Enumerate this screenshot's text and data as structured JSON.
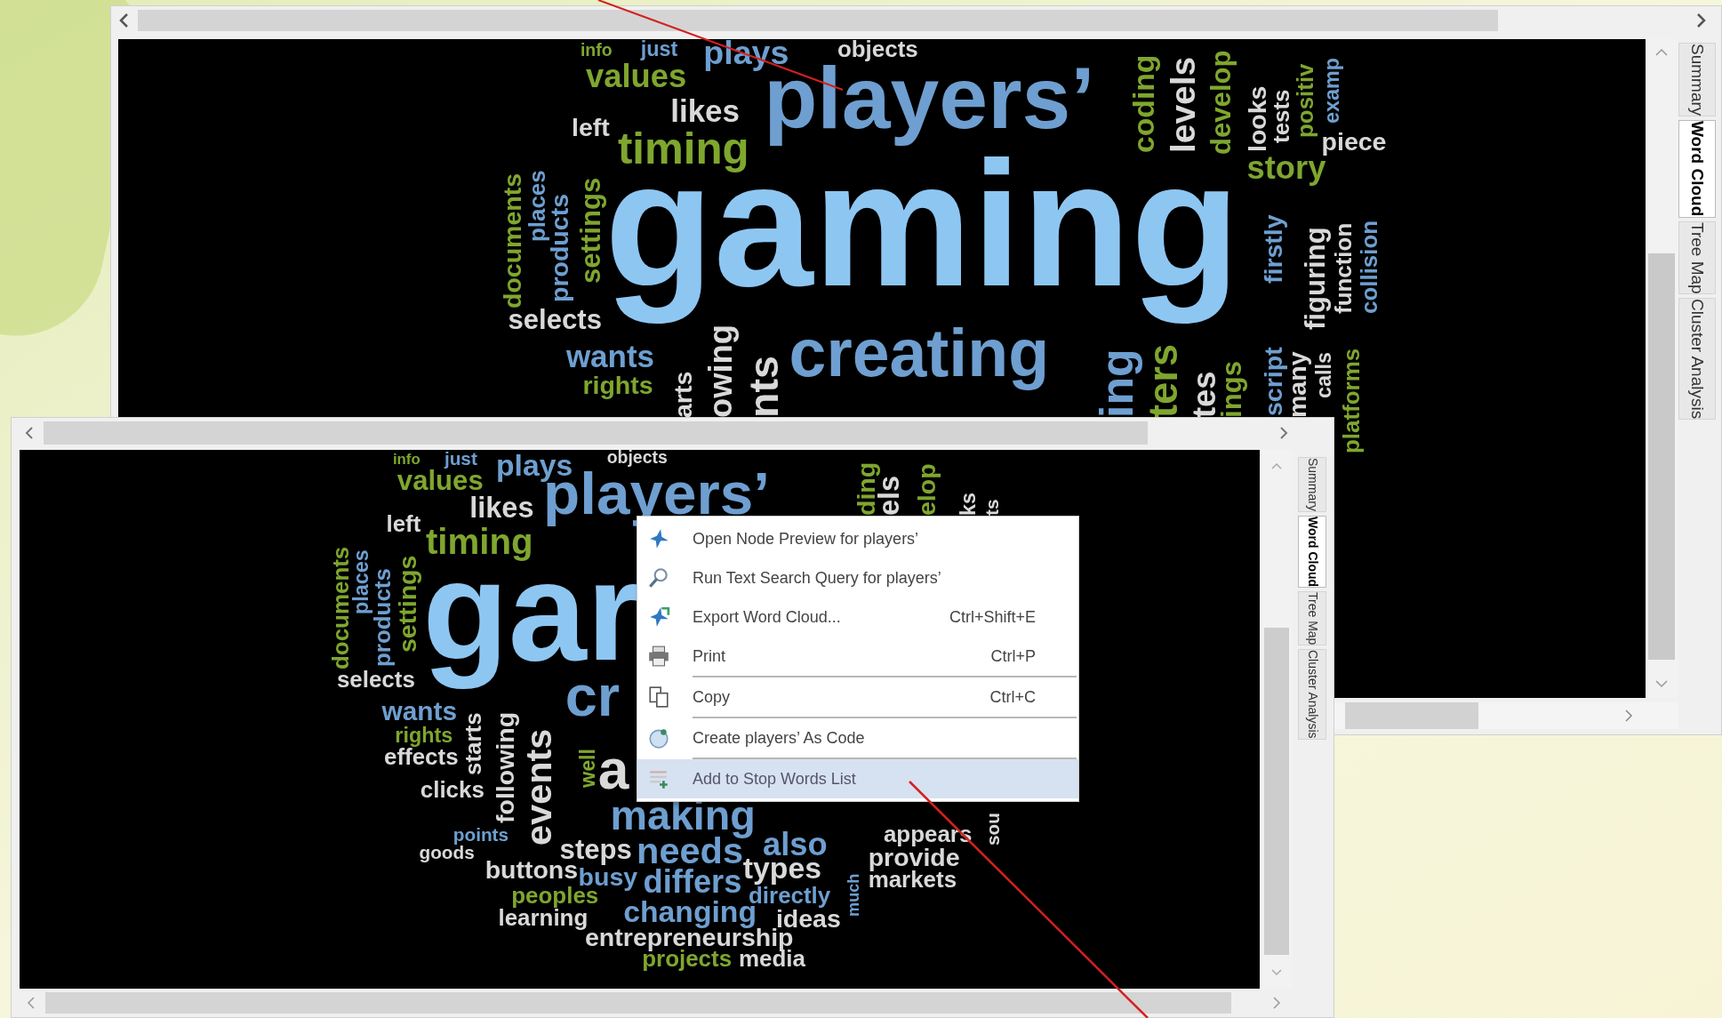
{
  "windows": [
    {
      "tabs": [
        {
          "label": "Summary",
          "selected": false
        },
        {
          "label": "Word Cloud",
          "selected": true
        },
        {
          "label": "Tree Map",
          "selected": false
        },
        {
          "label": "Cluster Analysis",
          "selected": false
        }
      ],
      "cloud": {
        "words": [
          {
            "text": "info",
            "color": "#7fa62f",
            "vertical": false
          },
          {
            "text": "just",
            "color": "#6e9fd0",
            "vertical": false
          },
          {
            "text": "plays",
            "color": "#6e9fd0",
            "vertical": false
          },
          {
            "text": "objects",
            "color": "#d9d9d9",
            "vertical": false
          },
          {
            "text": "values",
            "color": "#7fa62f",
            "vertical": false
          },
          {
            "text": "likes",
            "color": "#d9d9d9",
            "vertical": false
          },
          {
            "text": "left",
            "color": "#d9d9d9",
            "vertical": false
          },
          {
            "text": "players’",
            "color": "#6e9fd0",
            "vertical": false
          },
          {
            "text": "timing",
            "color": "#7fa62f",
            "vertical": false
          },
          {
            "text": "documents",
            "color": "#7fa62f",
            "vertical": true
          },
          {
            "text": "places",
            "color": "#6e9fd0",
            "vertical": true
          },
          {
            "text": "products",
            "color": "#6e9fd0",
            "vertical": true
          },
          {
            "text": "settings",
            "color": "#7fa62f",
            "vertical": true
          },
          {
            "text": "selects",
            "color": "#d9d9d9",
            "vertical": false
          },
          {
            "text": "gaming",
            "color": "#8ec6f2",
            "vertical": false
          },
          {
            "text": "wants",
            "color": "#6e9fd0",
            "vertical": false
          },
          {
            "text": "rights",
            "color": "#7fa62f",
            "vertical": false
          },
          {
            "text": "creating",
            "color": "#6e9fd0",
            "vertical": false
          },
          {
            "text": "coding",
            "color": "#7fa62f",
            "vertical": true
          },
          {
            "text": "levels",
            "color": "#d9d9d9",
            "vertical": true
          },
          {
            "text": "develop",
            "color": "#7fa62f",
            "vertical": true
          },
          {
            "text": "looks",
            "color": "#d9d9d9",
            "vertical": true
          },
          {
            "text": "tests",
            "color": "#d9d9d9",
            "vertical": true
          },
          {
            "text": "positiv",
            "color": "#7fa62f",
            "vertical": true
          },
          {
            "text": "examp",
            "color": "#6e9fd0",
            "vertical": true
          },
          {
            "text": "piece",
            "color": "#d9d9d9",
            "vertical": false
          },
          {
            "text": "story",
            "color": "#7fa62f",
            "vertical": false
          },
          {
            "text": "firstly",
            "color": "#6e9fd0",
            "vertical": true
          },
          {
            "text": "figuring",
            "color": "#d9d9d9",
            "vertical": true
          },
          {
            "text": "function",
            "color": "#d9d9d9",
            "vertical": true
          },
          {
            "text": "collision",
            "color": "#6e9fd0",
            "vertical": true
          },
          {
            "text": "script",
            "color": "#6e9fd0",
            "vertical": true
          },
          {
            "text": "many",
            "color": "#d9d9d9",
            "vertical": true
          },
          {
            "text": "calls",
            "color": "#d9d9d9",
            "vertical": true
          },
          {
            "text": "platforms",
            "color": "#7fa62f",
            "vertical": true
          },
          {
            "text": "nts",
            "color": "#d9d9d9",
            "vertical": true
          },
          {
            "text": "ing",
            "color": "#6e9fd0",
            "vertical": true
          },
          {
            "text": "ters",
            "color": "#7fa62f",
            "vertical": true
          },
          {
            "text": "tes",
            "color": "#d9d9d9",
            "vertical": true
          },
          {
            "text": "ings",
            "color": "#7fa62f",
            "vertical": true
          },
          {
            "text": "owing",
            "color": "#d9d9d9",
            "vertical": true
          },
          {
            "text": "arts",
            "color": "#d9d9d9",
            "vertical": true
          }
        ]
      }
    },
    {
      "tabs": [
        {
          "label": "Summary",
          "selected": false
        },
        {
          "label": "Word Cloud",
          "selected": true
        },
        {
          "label": "Tree Map",
          "selected": false
        },
        {
          "label": "Cluster Analysis",
          "selected": false
        }
      ],
      "cloud": {
        "words": [
          {
            "text": "info",
            "color": "#7fa62f",
            "vertical": false
          },
          {
            "text": "just",
            "color": "#6e9fd0",
            "vertical": false
          },
          {
            "text": "plays",
            "color": "#6e9fd0",
            "vertical": false
          },
          {
            "text": "objects",
            "color": "#d9d9d9",
            "vertical": false
          },
          {
            "text": "values",
            "color": "#7fa62f",
            "vertical": false
          },
          {
            "text": "likes",
            "color": "#d9d9d9",
            "vertical": false
          },
          {
            "text": "left",
            "color": "#d9d9d9",
            "vertical": false
          },
          {
            "text": "players’",
            "color": "#6e9fd0",
            "vertical": false
          },
          {
            "text": "timing",
            "color": "#7fa62f",
            "vertical": false
          },
          {
            "text": "documents",
            "color": "#7fa62f",
            "vertical": true
          },
          {
            "text": "places",
            "color": "#6e9fd0",
            "vertical": true
          },
          {
            "text": "products",
            "color": "#6e9fd0",
            "vertical": true
          },
          {
            "text": "settings",
            "color": "#7fa62f",
            "vertical": true
          },
          {
            "text": "selects",
            "color": "#d9d9d9",
            "vertical": false
          },
          {
            "text": "gar",
            "color": "#8ec6f2",
            "vertical": false
          },
          {
            "text": "wants",
            "color": "#6e9fd0",
            "vertical": false
          },
          {
            "text": "rights",
            "color": "#7fa62f",
            "vertical": false
          },
          {
            "text": "effects",
            "color": "#d9d9d9",
            "vertical": false
          },
          {
            "text": "clicks",
            "color": "#d9d9d9",
            "vertical": false
          },
          {
            "text": "points",
            "color": "#6e9fd0",
            "vertical": false
          },
          {
            "text": "goods",
            "color": "#d9d9d9",
            "vertical": false
          },
          {
            "text": "starts",
            "color": "#d9d9d9",
            "vertical": true
          },
          {
            "text": "following",
            "color": "#d9d9d9",
            "vertical": true
          },
          {
            "text": "events",
            "color": "#d9d9d9",
            "vertical": true
          },
          {
            "text": "well",
            "color": "#7fa62f",
            "vertical": true
          },
          {
            "text": "cr",
            "color": "#6e9fd0",
            "vertical": false
          },
          {
            "text": "a",
            "color": "#d9d9d9",
            "vertical": false
          },
          {
            "text": "making",
            "color": "#6e9fd0",
            "vertical": false
          },
          {
            "text": "steps",
            "color": "#d9d9d9",
            "vertical": false
          },
          {
            "text": "needs",
            "color": "#6e9fd0",
            "vertical": false
          },
          {
            "text": "also",
            "color": "#6e9fd0",
            "vertical": false
          },
          {
            "text": "buttons",
            "color": "#d9d9d9",
            "vertical": false
          },
          {
            "text": "busy",
            "color": "#6e9fd0",
            "vertical": false
          },
          {
            "text": "differs",
            "color": "#6e9fd0",
            "vertical": false
          },
          {
            "text": "types",
            "color": "#d9d9d9",
            "vertical": false
          },
          {
            "text": "peoples",
            "color": "#7fa62f",
            "vertical": false
          },
          {
            "text": "directly",
            "color": "#6e9fd0",
            "vertical": false
          },
          {
            "text": "learning",
            "color": "#d9d9d9",
            "vertical": false
          },
          {
            "text": "changing",
            "color": "#6e9fd0",
            "vertical": false
          },
          {
            "text": "ideas",
            "color": "#d9d9d9",
            "vertical": false
          },
          {
            "text": "entrepreneurship",
            "color": "#d9d9d9",
            "vertical": false
          },
          {
            "text": "projects",
            "color": "#7fa62f",
            "vertical": false
          },
          {
            "text": "media",
            "color": "#d9d9d9",
            "vertical": false
          },
          {
            "text": "much",
            "color": "#6e9fd0",
            "vertical": true
          },
          {
            "text": "appears",
            "color": "#d9d9d9",
            "vertical": false
          },
          {
            "text": "provide",
            "color": "#d9d9d9",
            "vertical": false
          },
          {
            "text": "markets",
            "color": "#d9d9d9",
            "vertical": false
          },
          {
            "text": "sou",
            "color": "#d9d9d9",
            "vertical": true
          },
          {
            "text": "ding",
            "color": "#7fa62f",
            "vertical": true
          },
          {
            "text": "els",
            "color": "#d9d9d9",
            "vertical": true
          },
          {
            "text": "elop",
            "color": "#7fa62f",
            "vertical": true
          },
          {
            "text": "ks",
            "color": "#d9d9d9",
            "vertical": true
          },
          {
            "text": "ts",
            "color": "#d9d9d9",
            "vertical": true
          }
        ]
      }
    }
  ],
  "context_menu": {
    "items": [
      {
        "label": "Open Node Preview for players’",
        "separator_before": false,
        "selected": false
      },
      {
        "label": "Run Text Search Query for players’",
        "separator_before": false,
        "selected": false
      },
      {
        "label": "Export Word Cloud...",
        "shortcut": "Ctrl+Shift+E",
        "separator_before": false,
        "selected": false
      },
      {
        "label": "Print",
        "shortcut": "Ctrl+P",
        "separator_before": false,
        "selected": false
      },
      {
        "label": "Copy",
        "shortcut": "Ctrl+C",
        "separator_before": true,
        "selected": false
      },
      {
        "label": "Create players’ As Code",
        "separator_before": true,
        "selected": false
      },
      {
        "label": "Add to Stop Words List",
        "separator_before": true,
        "selected": true
      }
    ]
  }
}
